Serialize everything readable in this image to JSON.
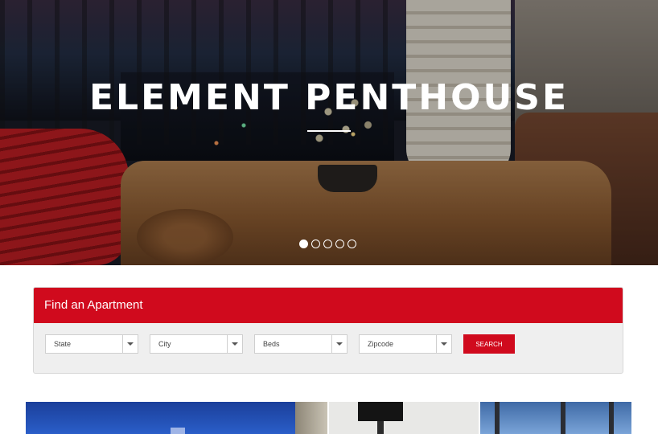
{
  "hero": {
    "title": "ELEMENT PENTHOUSE",
    "slides": 5,
    "active_slide": 1
  },
  "search": {
    "heading": "Find an Apartment",
    "fields": [
      {
        "label": "State"
      },
      {
        "label": "City"
      },
      {
        "label": "Beds"
      },
      {
        "label": "Zipcode"
      }
    ],
    "button_label": "SEARCH"
  },
  "colors": {
    "accent": "#d00a1d",
    "card_background": "#efefef"
  }
}
